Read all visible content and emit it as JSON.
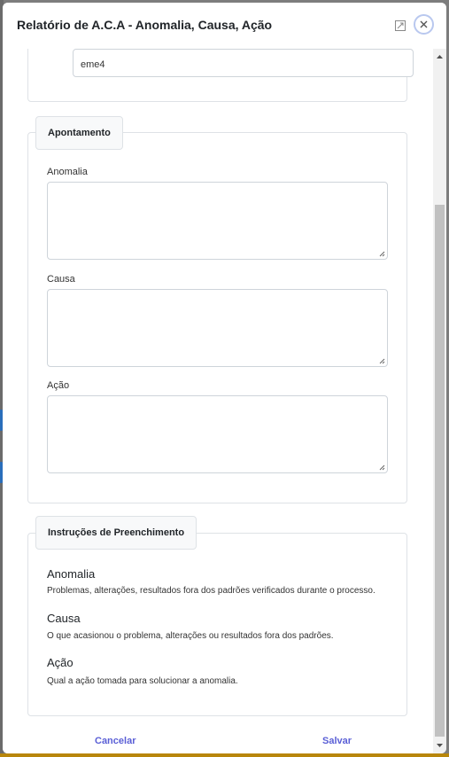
{
  "modal": {
    "title": "Relatório de A.C.A - Anomalia, Causa, Ação"
  },
  "top_field": {
    "value": "eme4"
  },
  "apontamento": {
    "legend": "Apontamento",
    "fields": [
      {
        "label": "Anomalia",
        "value": ""
      },
      {
        "label": "Causa",
        "value": ""
      },
      {
        "label": "Ação",
        "value": ""
      }
    ]
  },
  "instrucoes": {
    "legend": "Instruções de Preenchimento",
    "items": [
      {
        "title": "Anomalia",
        "text": "Problemas, alterações, resultados fora dos padrões verificados durante o processo."
      },
      {
        "title": "Causa",
        "text": "O que acasionou o problema, alterações ou resultados fora dos padrões."
      },
      {
        "title": "Ação",
        "text": "Qual a ação tomada para solucionar a anomalia."
      }
    ]
  },
  "footer": {
    "cancel_label": "Cancelar",
    "save_label": "Salvar"
  },
  "colors": {
    "accent": "#5a5fd6",
    "close_ring": "#b9c8ef"
  },
  "icons": {
    "expand": "expand-icon",
    "close": "close-icon"
  }
}
